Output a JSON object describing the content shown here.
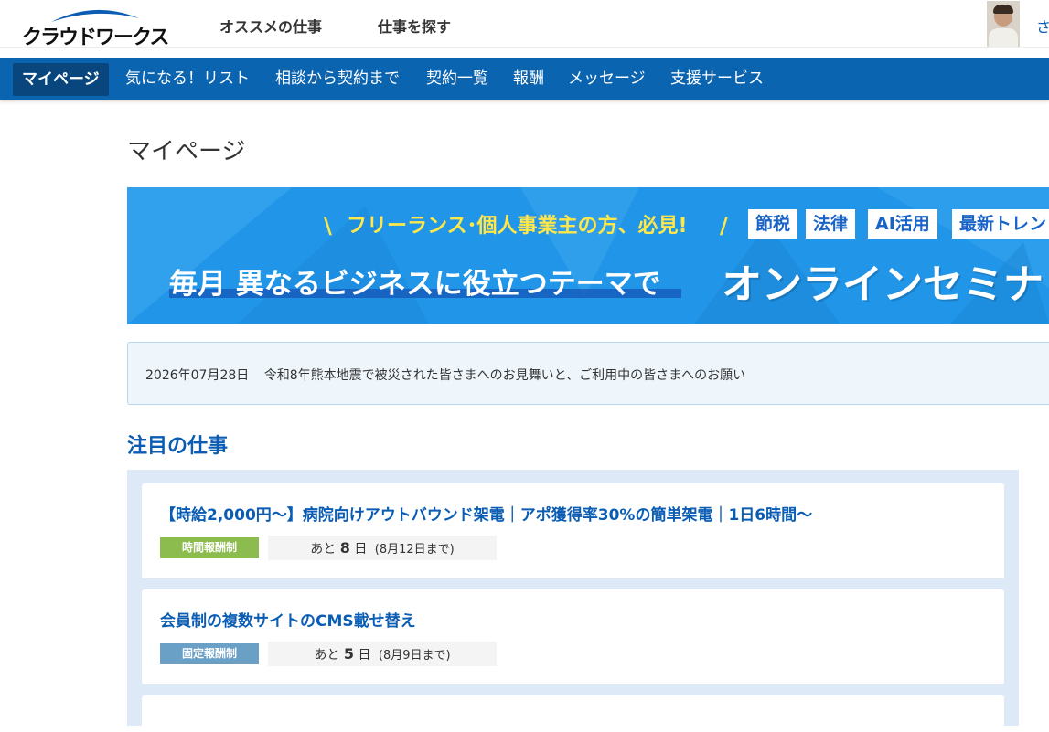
{
  "header": {
    "logo_text": "クラウドワークス",
    "nav": [
      "オススメの仕事",
      "仕事を探す"
    ],
    "edge_text": "さ"
  },
  "main_nav": {
    "items": [
      "マイページ",
      "気になる！リスト",
      "相談から契約まで",
      "契約一覧",
      "報酬",
      "メッセージ",
      "支援サービス"
    ],
    "active": "マイページ"
  },
  "page_title": "マイページ",
  "banner": {
    "subtitle": "フリーランス･個人事業主の方、必見!",
    "tags": [
      "節税",
      "法律",
      "AI活用",
      "最新トレン"
    ],
    "headline": "毎月 異なるビジネスに役立つテーマで",
    "headline_big": "オンラインセミナ",
    "colors": {
      "bg": "#2196e8",
      "accent_text": "#ffe74a"
    }
  },
  "notice": {
    "date": "2026年07月28日",
    "text": "令和8年熊本地震で被災された皆さまへのお見舞いと、ご利用中の皆さまへのお願い"
  },
  "featured": {
    "title": "注目の仕事",
    "jobs": [
      {
        "title": "【時給2,000円～】病院向けアウトバウンド架電｜アポ獲得率30%の簡単架電｜1日6時間～",
        "type": "時間報酬制",
        "type_color": "#8cbb4e",
        "remaining_prefix": "あと",
        "remaining_days": "8",
        "remaining_unit": "日",
        "deadline": "(8月12日まで)"
      },
      {
        "title": "会員制の複数サイトのCMS載せ替え",
        "type": "固定報酬制",
        "type_color": "#6a9fc6",
        "remaining_prefix": "あと",
        "remaining_days": "5",
        "remaining_unit": "日",
        "deadline": "(8月9日まで)"
      }
    ]
  }
}
